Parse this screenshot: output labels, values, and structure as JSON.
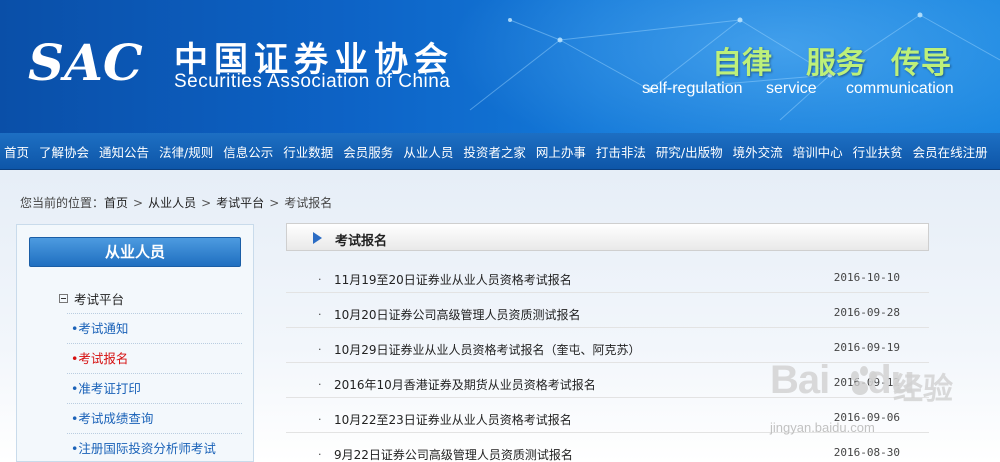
{
  "header": {
    "logo_mark": "SAC",
    "org_name_cn": "中国证券业协会",
    "org_name_en": "Securities Association of China",
    "slogans": [
      {
        "cn": "自律",
        "en": "self-regulation"
      },
      {
        "cn": "服务",
        "en": "service"
      },
      {
        "cn": "传导",
        "en": "communication"
      }
    ],
    "accent_color": "#bdf07a"
  },
  "nav": {
    "items": [
      "首页",
      "了解协会",
      "通知公告",
      "法律/规则",
      "信息公示",
      "行业数据",
      "会员服务",
      "从业人员",
      "投资者之家",
      "网上办事",
      "打击非法",
      "研究/出版物",
      "境外交流",
      "培训中心",
      "行业扶贫",
      "会员在线注册"
    ]
  },
  "breadcrumb": {
    "prefix": "您当前的位置：",
    "items": [
      "首页",
      "从业人员",
      "考试平台",
      "考试报名"
    ],
    "separator": ">"
  },
  "sidebar": {
    "title": "从业人员",
    "group": "考试平台",
    "items": [
      {
        "label": "•考试通知",
        "active": false
      },
      {
        "label": "•考试报名",
        "active": true
      },
      {
        "label": "•准考证打印",
        "active": false
      },
      {
        "label": "•考试成绩查询",
        "active": false
      },
      {
        "label": "•注册国际投资分析师考试",
        "active": false
      }
    ]
  },
  "main": {
    "section_title": "考试报名",
    "bullet": "·",
    "rows": [
      {
        "title": "11月19至20日证券业从业人员资格考试报名",
        "date": "2016-10-10"
      },
      {
        "title": "10月20日证券公司高级管理人员资质测试报名",
        "date": "2016-09-28"
      },
      {
        "title": "10月29日证券业从业人员资格考试报名（奎屯、阿克苏）",
        "date": "2016-09-19"
      },
      {
        "title": "2016年10月香港证券及期货从业员资格考试报名",
        "date": "2016-09-12"
      },
      {
        "title": "10月22至23日证券业从业人员资格考试报名",
        "date": "2016-09-06"
      },
      {
        "title": "9月22日证券公司高级管理人员资质测试报名",
        "date": "2016-08-30"
      }
    ]
  },
  "watermark": {
    "brand": "Bai",
    "brand2": "du",
    "cn": "经验",
    "url": "jingyan.baidu.com"
  }
}
